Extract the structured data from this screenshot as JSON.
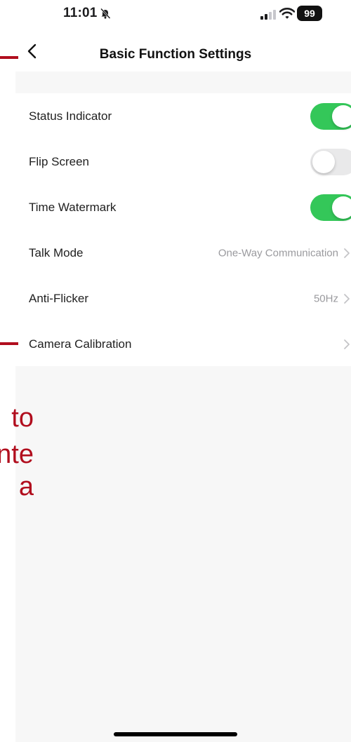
{
  "status_bar": {
    "time": "11:01",
    "battery": "99",
    "icons": [
      "bell-off-icon",
      "signal-icon",
      "wifi-icon",
      "battery-icon"
    ]
  },
  "nav": {
    "title": "Basic Function Settings",
    "back_icon": "chevron-left-icon"
  },
  "settings": [
    {
      "label": "Status Indicator",
      "type": "toggle",
      "on": true
    },
    {
      "label": "Flip Screen",
      "type": "toggle",
      "on": false
    },
    {
      "label": "Time Watermark",
      "type": "toggle",
      "on": true
    },
    {
      "label": "Talk Mode",
      "type": "link",
      "value": "One-Way Communication"
    },
    {
      "label": "Anti-Flicker",
      "type": "link",
      "value": "50Hz"
    },
    {
      "label": "Camera Calibration",
      "type": "link",
      "value": ""
    }
  ],
  "annotation": {
    "lines": [
      "to",
      "nte",
      "a"
    ]
  },
  "colors": {
    "toggle_on": "#34c759",
    "toggle_off": "#e9e9ea",
    "annotation": "#b10e1e",
    "background": "#f7f7f7",
    "secondary_text": "#9a9a9e"
  }
}
